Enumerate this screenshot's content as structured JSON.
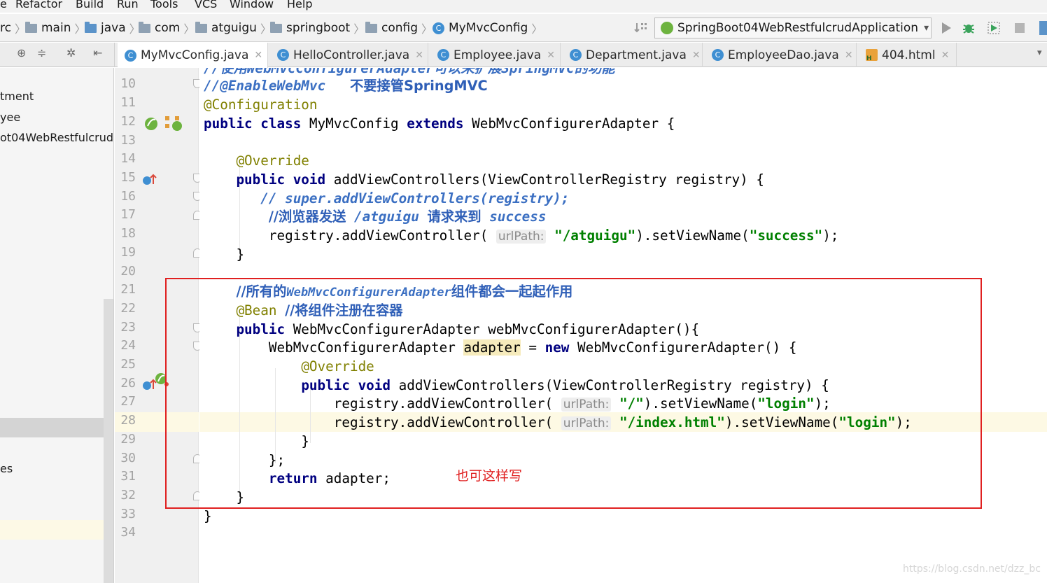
{
  "menu": [
    "e",
    "Refactor",
    "Build",
    "Run",
    "Tools",
    "VCS",
    "Window",
    "Help"
  ],
  "breadcrumb": [
    "rc",
    "main",
    "java",
    "com",
    "atguigu",
    "springboot",
    "config",
    "MyMvcConfig"
  ],
  "run_config": {
    "label": "SpringBoot04WebRestfulcrudApplication"
  },
  "tabs": [
    "MyMvcConfig.java",
    "HelloController.java",
    "Employee.java",
    "Department.java",
    "EmployeeDao.java",
    "404.html"
  ],
  "project_tree": [
    "tment",
    "yee",
    "ot04WebRestfulcrud",
    "es"
  ],
  "line_numbers": [
    "10",
    "11",
    "12",
    "13",
    "14",
    "15",
    "16",
    "17",
    "18",
    "19",
    "20",
    "21",
    "22",
    "23",
    "24",
    "25",
    "26",
    "27",
    "28",
    "29",
    "30",
    "31",
    "32",
    "33",
    "34"
  ],
  "code": {
    "partial_top": "//使用WebMvcConfigurerAdapter可以来扩展SpringMVC的功能",
    "l10_comment": "//@EnableWebMvc",
    "l10_cn": "不要接管SpringMVC",
    "l11": "@Configuration",
    "l12_kw1": "public",
    "l12_kw2": "class",
    "l12_name": "MyMvcConfig",
    "l12_kw3": "extends",
    "l12_rest": "WebMvcConfigurerAdapter {",
    "l14": "@Override",
    "l15_kw": "public void",
    "l15_rest": "addViewControllers(ViewControllerRegistry registry) {",
    "l16": "// super.addViewControllers(registry);",
    "l17_a": "//浏览器发送",
    "l17_b": "/atguigu",
    "l17_c": "请求来到",
    "l17_d": "success",
    "l18_a": "registry.addViewController(",
    "l18_hint": "urlPath:",
    "l18_str1": "\"/atguigu\"",
    "l18_mid": ").setViewName(",
    "l18_str2": "\"success\"",
    "l18_end": ");",
    "l19": "}",
    "l21_a": "//所有的",
    "l21_b": "WebMvcConfigurerAdapter",
    "l21_c": "组件都会一起起作用",
    "l22_ann": "@Bean",
    "l22_cm": "//将组件注册在容器",
    "l23_kw": "public",
    "l23_rest": "WebMvcConfigurerAdapter webMvcConfigurerAdapter(){",
    "l24_a": "WebMvcConfigurerAdapter",
    "l24_var": "adapter",
    "l24_b": "=",
    "l24_kw": "new",
    "l24_c": "WebMvcConfigurerAdapter() {",
    "l25": "@Override",
    "l26_kw": "public void",
    "l26_rest": "addViewControllers(ViewControllerRegistry registry) {",
    "l27_a": "registry.addViewController(",
    "l27_hint": "urlPath:",
    "l27_str1": "\"/\"",
    "l27_mid": ").setViewName(",
    "l27_str2": "\"login\"",
    "l27_end": ");",
    "l28_a": "registry.addViewController(",
    "l28_hint": "urlPath:",
    "l28_str1": "\"/index.html\"",
    "l28_mid": ").setViewName(",
    "l28_str2": "\"login\"",
    "l28_end": ");",
    "l29": "}",
    "l30": "};",
    "l31_kw": "return",
    "l31_rest": "adapter;",
    "l32": "}",
    "l33": "}"
  },
  "annotation_note": "也可这样写",
  "watermark": "https://blog.csdn.net/dzz_bc",
  "colors": {
    "keyword": "#000080",
    "annotation": "#808000",
    "comment": "#3b6fc2",
    "string": "#008000",
    "highlight_box": "#e02020"
  }
}
